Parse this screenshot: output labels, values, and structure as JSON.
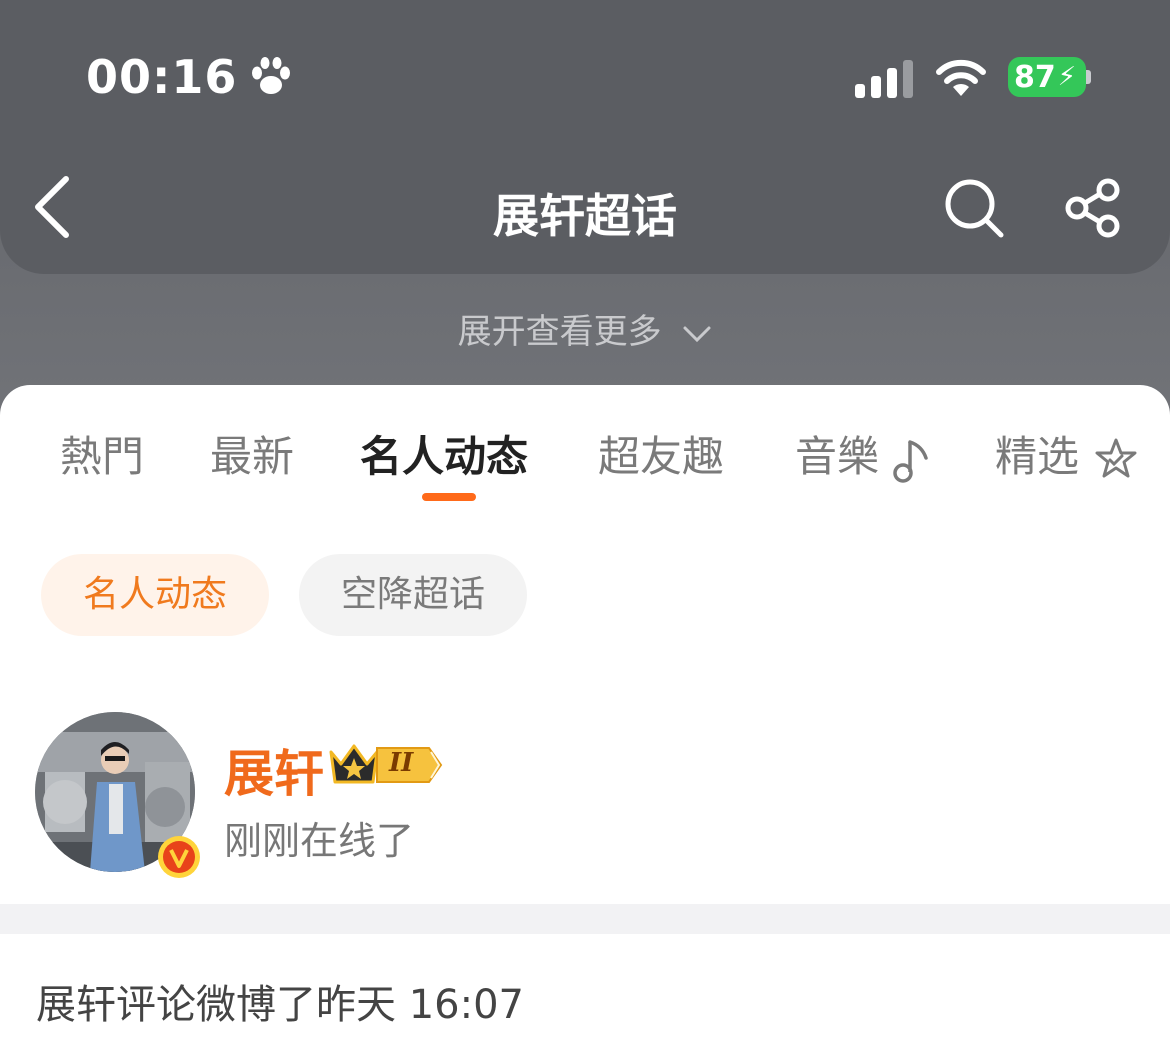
{
  "status_bar": {
    "time": "00:16",
    "battery": "87",
    "battery_color": "#34c759",
    "icons": [
      "paw-icon",
      "signal-icon",
      "wifi-icon",
      "battery-icon"
    ]
  },
  "header": {
    "title": "展轩超话",
    "expand_label": "展开查看更多",
    "icons": [
      "back-icon",
      "search-icon",
      "share-icon",
      "chevron-down-icon"
    ]
  },
  "tabs": [
    {
      "label": "熱門"
    },
    {
      "label": "最新"
    },
    {
      "label": "名人动态",
      "active": true
    },
    {
      "label": "超友趣"
    },
    {
      "label": "音樂"
    },
    {
      "label": "精选"
    }
  ],
  "chips": [
    {
      "label": "名人动态",
      "active": true
    },
    {
      "label": "空降超话",
      "active": false
    }
  ],
  "user": {
    "name": "展轩",
    "level": "II",
    "status": "刚刚在线了",
    "verified_badge": "V"
  },
  "post": {
    "summary": "展轩评论微博了昨天 16:07"
  },
  "colors": {
    "accent": "#ff6a1a",
    "username": "#f06a1c",
    "chip_active_bg": "#fff3ea"
  }
}
